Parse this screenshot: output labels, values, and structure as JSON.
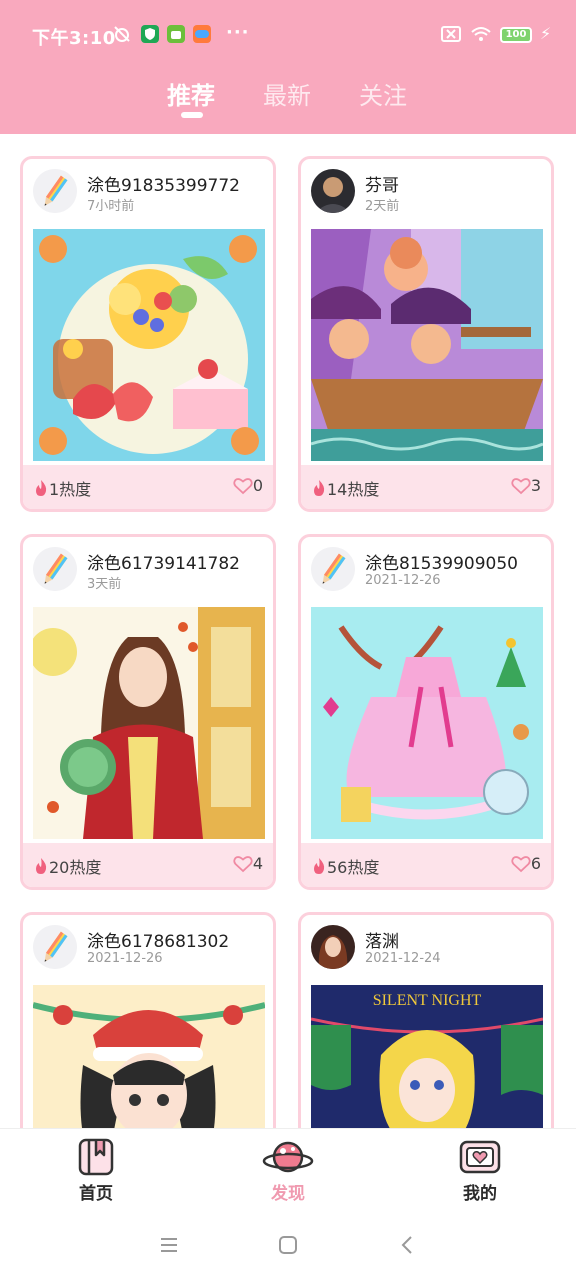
{
  "status_bar": {
    "time": "下午3:10",
    "dots": "···",
    "battery": "100"
  },
  "tabs": [
    {
      "label": "推荐"
    },
    {
      "label": "最新"
    },
    {
      "label": "关注"
    }
  ],
  "posts": [
    {
      "author": "涂色91835399772",
      "time": "7小时前",
      "heat": "1热度",
      "likes": "0",
      "avatar": "pencil-avatar-icon",
      "art": "fruit-dessert-artwork"
    },
    {
      "author": "芬哥",
      "time": "2天前",
      "heat": "14热度",
      "likes": "3",
      "avatar": "user-photo",
      "art": "pirate-ship-artwork"
    },
    {
      "author": "涂色61739141782",
      "time": "3天前",
      "heat": "20热度",
      "likes": "4",
      "avatar": "pencil-avatar-icon",
      "art": "chinese-lady-artwork"
    },
    {
      "author": "涂色81539909050",
      "time": "2021-12-26",
      "heat": "56热度",
      "likes": "6",
      "avatar": "pencil-avatar-icon",
      "art": "christmas-dress-artwork"
    },
    {
      "author": "涂色6178681302",
      "time": "2021-12-26",
      "heat": "",
      "likes": "",
      "avatar": "pencil-avatar-icon",
      "art": "christmas-girl-artwork"
    },
    {
      "author": "落渊",
      "time": "2021-12-24",
      "heat": "",
      "likes": "",
      "avatar": "user-photo",
      "art": "silent-night-artwork",
      "art_text": "SILENT NIGHT"
    }
  ],
  "bottom_nav": [
    {
      "label": "首页",
      "icon": "bookmark-book-icon"
    },
    {
      "label": "发现",
      "icon": "planet-icon"
    },
    {
      "label": "我的",
      "icon": "heart-frame-icon"
    }
  ],
  "colors": {
    "brand_pink": "#f9a9be",
    "card_border": "#fcd0dc",
    "footer_pink": "#fde3ea",
    "active_nav": "#f09ab0",
    "flame": "#f0607e"
  }
}
